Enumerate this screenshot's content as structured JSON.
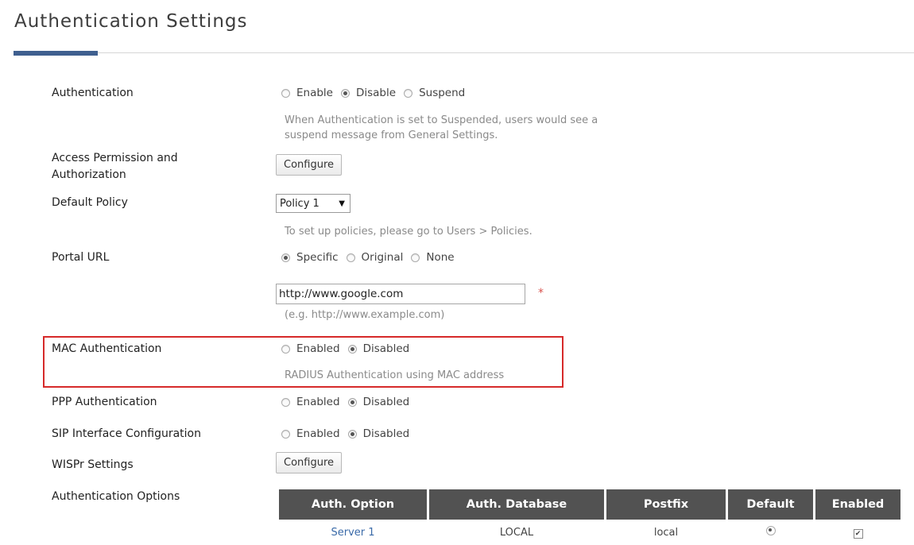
{
  "page": {
    "title": "Authentication Settings"
  },
  "authentication": {
    "label": "Authentication",
    "options": [
      "Enable",
      "Disable",
      "Suspend"
    ],
    "selected": "Disable",
    "hint_line1": "When Authentication is set to Suspended, users would see a",
    "hint_line2": "suspend message from General Settings."
  },
  "access_permission": {
    "label_line1": "Access Permission and",
    "label_line2": "Authorization",
    "button": "Configure"
  },
  "default_policy": {
    "label": "Default Policy",
    "value": "Policy 1",
    "arrow": "▼",
    "hint": "To set up policies, please go to Users > Policies."
  },
  "portal_url": {
    "label": "Portal URL",
    "options": [
      "Specific",
      "Original",
      "None"
    ],
    "selected": "Specific",
    "value": "http://www.google.com",
    "required_mark": "*",
    "example": "(e.g. http://www.example.com)"
  },
  "mac_auth": {
    "label": "MAC Authentication",
    "options": [
      "Enabled",
      "Disabled"
    ],
    "selected": "Disabled",
    "hint": "RADIUS Authentication using MAC address"
  },
  "ppp_auth": {
    "label": "PPP Authentication",
    "options": [
      "Enabled",
      "Disabled"
    ],
    "selected": "Disabled"
  },
  "sip": {
    "label": "SIP Interface Configuration",
    "options": [
      "Enabled",
      "Disabled"
    ],
    "selected": "Disabled"
  },
  "wispr": {
    "label": "WISPr Settings",
    "button": "Configure"
  },
  "auth_options": {
    "label": "Authentication Options",
    "columns": [
      "Auth. Option",
      "Auth. Database",
      "Postfix",
      "Default",
      "Enabled"
    ],
    "rows": [
      {
        "option": "Server 1",
        "database": "LOCAL",
        "postfix": "local",
        "default": true,
        "enabled": true
      }
    ]
  },
  "colors": {
    "accent": "#3f5f8f",
    "highlight": "#d62a2a",
    "table_header": "#525252"
  }
}
